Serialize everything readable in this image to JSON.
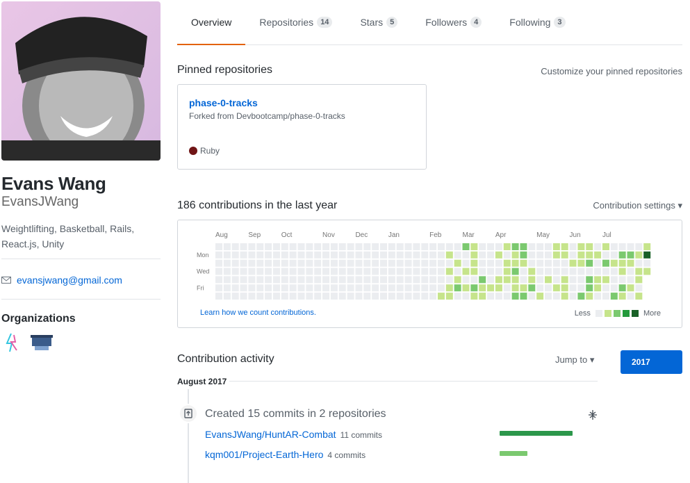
{
  "profile": {
    "fullname": "Evans Wang",
    "username": "EvansJWang",
    "bio": "Weightlifting, Basketball, Rails, React.js, Unity",
    "email": "evansjwang@gmail.com",
    "organizations_title": "Organizations"
  },
  "tabs": [
    {
      "label": "Overview",
      "count": ""
    },
    {
      "label": "Repositories",
      "count": "14"
    },
    {
      "label": "Stars",
      "count": "5"
    },
    {
      "label": "Followers",
      "count": "4"
    },
    {
      "label": "Following",
      "count": "3"
    }
  ],
  "pinned": {
    "title": "Pinned repositories",
    "customize": "Customize your pinned repositories",
    "repo": {
      "name": "phase-0-tracks",
      "fork": "Forked from Devbootcamp/phase-0-tracks",
      "language": "Ruby",
      "language_color": "#701516"
    }
  },
  "contributions": {
    "title": "186 contributions in the last year",
    "settings": "Contribution settings ▾",
    "months": [
      "Aug",
      "Sep",
      "Oct",
      "Nov",
      "Dec",
      "Jan",
      "Feb",
      "Mar",
      "Apr",
      "May",
      "Jun",
      "Jul"
    ],
    "days": [
      "Mon",
      "Wed",
      "Fri"
    ],
    "learn_link": "Learn how we count contributions.",
    "legend_less": "Less",
    "legend_more": "More",
    "levels": [
      "#ebedf0",
      "#c6e48b",
      "#7bc96f",
      "#239a3b",
      "#196127"
    ]
  },
  "activity": {
    "title": "Contribution activity",
    "jump_to": "Jump to ▾",
    "year": "2017",
    "month": "August 2017",
    "summary": "Created 15 commits in 2 repositories",
    "repos": [
      {
        "name": "EvansJWang/HuntAR-Combat",
        "commits": "11 commits",
        "share": 1.0,
        "color": "#2c974b"
      },
      {
        "name": "kqm001/Project-Earth-Hero",
        "commits": "4 commits",
        "share": 0.38,
        "color": "#7bc96f"
      }
    ]
  }
}
